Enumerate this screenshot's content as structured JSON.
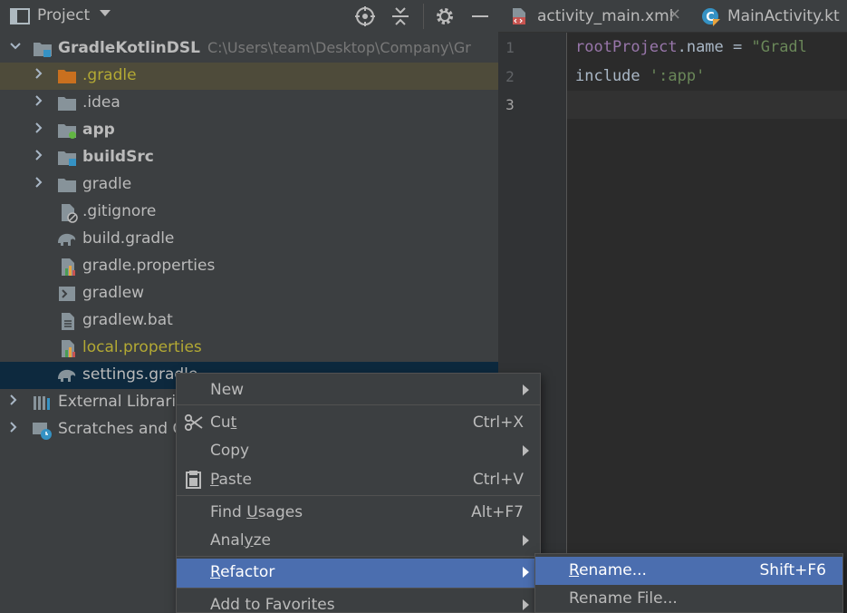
{
  "colors": {
    "panel_bg": "#3c3f41",
    "editor_bg": "#2b2b2b",
    "selection_row": "#0d293e",
    "highlight_row": "#4e4b3a",
    "menu_selected": "#4b6eaf",
    "folder_orange": "#c9701f",
    "ignored_text": "#b3a934",
    "keyword_purple": "#9876aa",
    "string_green": "#6a8759"
  },
  "panel": {
    "title": "Project",
    "toolbar_icons": [
      "locate-icon",
      "collapse-all-icon",
      "gear-icon",
      "minimize-icon"
    ]
  },
  "tree": {
    "root": {
      "name": "GradleKotlinDSL",
      "path": "C:\\Users\\team\\Desktop\\Company\\Gr"
    },
    "items": [
      {
        "name": ".gradle",
        "icon": "folder-icon"
      },
      {
        "name": ".idea",
        "icon": "folder-icon"
      },
      {
        "name": "app",
        "icon": "module-folder-icon"
      },
      {
        "name": "buildSrc",
        "icon": "module-folder-icon"
      },
      {
        "name": "gradle",
        "icon": "folder-icon"
      },
      {
        "name": ".gitignore",
        "icon": "ignore-file-icon"
      },
      {
        "name": "build.gradle",
        "icon": "gradle-elephant-icon"
      },
      {
        "name": "gradle.properties",
        "icon": "properties-file-icon"
      },
      {
        "name": "gradlew",
        "icon": "shell-script-icon"
      },
      {
        "name": "gradlew.bat",
        "icon": "text-file-icon"
      },
      {
        "name": "local.properties",
        "icon": "properties-file-icon"
      },
      {
        "name": "settings.gradle",
        "icon": "gradle-elephant-icon"
      }
    ],
    "external_libraries": "External Libraries",
    "scratches": "Scratches and Consoles"
  },
  "editor": {
    "tabs": [
      {
        "label": "activity_main.xml",
        "icon": "xml-layout-icon",
        "close": "×"
      },
      {
        "label": "MainActivity.kt",
        "icon": "kotlin-class-icon"
      }
    ],
    "line_numbers": [
      "1",
      "2",
      "3"
    ],
    "lines": [
      {
        "keyword": "rootProject",
        "rest": ".name = ",
        "string": "\"Gradl"
      },
      {
        "plain": "include ",
        "string": "':app'"
      }
    ]
  },
  "context_menu": {
    "items": [
      {
        "label": "New",
        "submenu": true
      },
      {
        "label": "Cut",
        "mnemonic": "t",
        "shortcut": "Ctrl+X",
        "icon": "scissors-icon"
      },
      {
        "label": "Copy",
        "submenu": true
      },
      {
        "label": "Paste",
        "mnemonic": "P",
        "shortcut": "Ctrl+V",
        "icon": "clipboard-icon"
      },
      {
        "label": "Find Usages",
        "mnemonic": "U",
        "shortcut": "Alt+F7"
      },
      {
        "label": "Analyze",
        "mnemonic": "z",
        "submenu": true
      },
      {
        "label": "Refactor",
        "mnemonic": "R",
        "submenu": true,
        "selected": true
      },
      {
        "label": "Add to Favorites",
        "submenu": true
      }
    ]
  },
  "refactor_submenu": {
    "items": [
      {
        "label": "Rename...",
        "mnemonic": "R",
        "shortcut": "Shift+F6",
        "selected": true
      },
      {
        "label": "Rename File..."
      }
    ]
  }
}
